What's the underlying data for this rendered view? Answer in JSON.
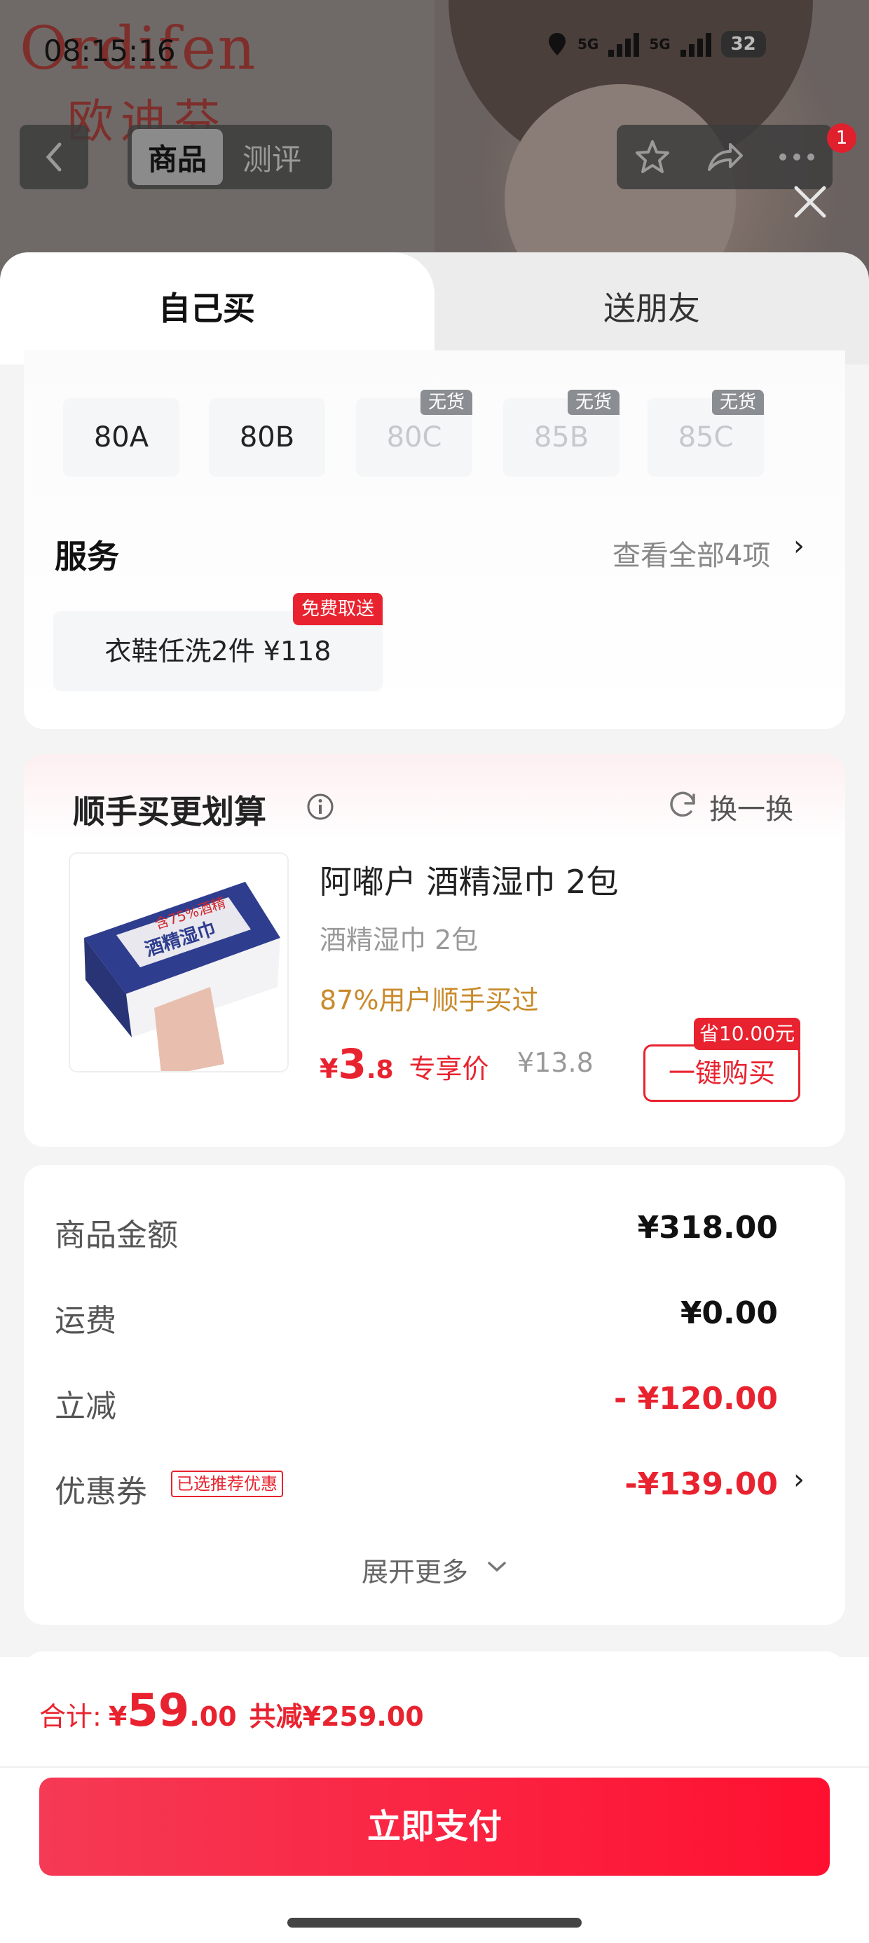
{
  "status_bar": {
    "time": "08:15:16",
    "network1": "5G",
    "network2": "5G",
    "battery": "32"
  },
  "background": {
    "brand_latin": "Ordifen",
    "brand_cn": "欧迪芬",
    "nav_tab_product": "商品",
    "nav_tab_review": "测评",
    "notification_count": "1"
  },
  "sheet_tabs": {
    "self": "自己买",
    "gift": "送朋友"
  },
  "sizes": [
    {
      "label": "80A",
      "available": true,
      "tag": ""
    },
    {
      "label": "80B",
      "available": true,
      "tag": ""
    },
    {
      "label": "80C",
      "available": false,
      "tag": "无货"
    },
    {
      "label": "85B",
      "available": false,
      "tag": "无货"
    },
    {
      "label": "85C",
      "available": false,
      "tag": "无货"
    }
  ],
  "service": {
    "title": "服务",
    "view_all": "查看全部4项",
    "item": "衣鞋任洗2件  ¥118",
    "badge": "免费取送"
  },
  "upsell": {
    "title": "顺手买更划算",
    "swap_label": "换一换",
    "product_name": "阿嘟户 酒精湿巾 2包",
    "product_desc": "酒精湿巾 2包",
    "purchase_stat": "87%用户顺手买过",
    "price_currency": "¥",
    "price_int": "3",
    "price_dec": ".8",
    "price_label": "专享价",
    "original_price": "¥13.8",
    "save_tag": "省10.00元",
    "buy_button": "一键购买",
    "image_labels": {
      "top": "含75%酒精",
      "main": "酒精湿巾"
    }
  },
  "price_breakdown": {
    "rows": [
      {
        "label": "商品金额",
        "value": "¥318.00"
      },
      {
        "label": "运费",
        "value": "¥0.00"
      },
      {
        "label": "立减",
        "value": "- ¥120.00"
      },
      {
        "label": "优惠券",
        "value": "-¥139.00"
      }
    ],
    "coupon_tag": "已选推荐优惠",
    "expand_more": "展开更多"
  },
  "footer": {
    "total_label": "合计:",
    "total_currency": "¥",
    "total_int": "59",
    "total_dec": ".00",
    "total_saved": "共减¥259.00",
    "pay_button": "立即支付"
  },
  "colors": {
    "accent_red": "#e8232f",
    "stat_orange": "#c98a2b",
    "pay_gradient_start": "#f53a55",
    "pay_gradient_end": "#ff1030"
  }
}
